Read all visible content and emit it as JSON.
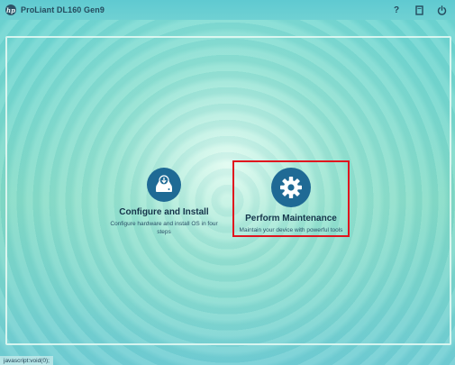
{
  "header": {
    "logo_text": "hp",
    "title": "ProLiant DL160 Gen9",
    "icons": [
      "help-icon",
      "documentation-icon",
      "power-icon"
    ],
    "help_glyph": "?"
  },
  "tiles": {
    "configure": {
      "title": "Configure and Install",
      "description_line1": "Configure hardware and install OS in four",
      "description_line2": "steps",
      "icon": "download-drive-icon"
    },
    "maintain": {
      "title": "Perform Maintenance",
      "description": "Maintain your device with powerful tools",
      "icon": "gear-icon",
      "highlighted": true
    }
  },
  "status_bar": {
    "text": "javascript:void(0);"
  },
  "colors": {
    "accent": "#1f6a95",
    "highlight_border": "#e0151e",
    "text_dark": "#15344a"
  }
}
